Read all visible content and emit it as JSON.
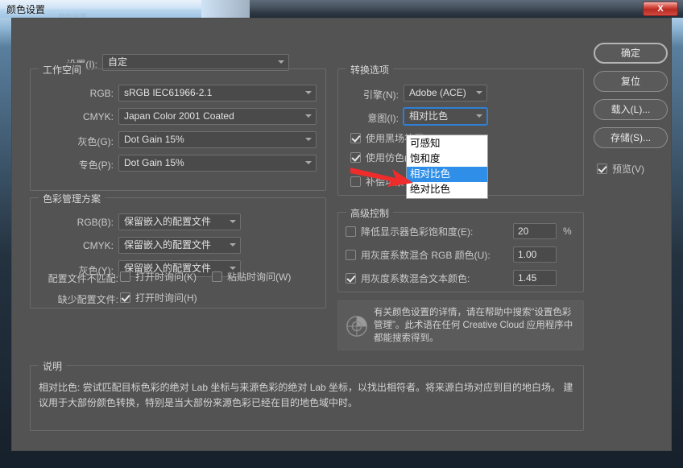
{
  "window": {
    "title": "颜色设置",
    "close_label": "X",
    "ghost_title": "颜色设置"
  },
  "settings_row": {
    "label": "设置(I):",
    "value": "自定"
  },
  "working_spaces": {
    "legend": "工作空间",
    "rows": [
      {
        "label": "RGB:",
        "value": "sRGB IEC61966-2.1"
      },
      {
        "label": "CMYK:",
        "value": "Japan Color 2001 Coated"
      },
      {
        "label": "灰色(G):",
        "value": "Dot Gain 15%"
      },
      {
        "label": "专色(P):",
        "value": "Dot Gain 15%"
      }
    ]
  },
  "color_management": {
    "legend": "色彩管理方案",
    "rows": [
      {
        "label": "RGB(B):",
        "value": "保留嵌入的配置文件"
      },
      {
        "label": "CMYK:",
        "value": "保留嵌入的配置文件"
      },
      {
        "label": "灰色(Y):",
        "value": "保留嵌入的配置文件"
      }
    ],
    "mismatch_label": "配置文件不匹配:",
    "mismatch_open": {
      "label": "打开时询问(K)",
      "checked": false
    },
    "mismatch_paste": {
      "label": "粘贴时询问(W)",
      "checked": false
    },
    "missing_label": "缺少配置文件:",
    "missing_open": {
      "label": "打开时询问(H)",
      "checked": true
    }
  },
  "conversion_options": {
    "legend": "转换选项",
    "engine_label": "引擎(N):",
    "engine_value": "Adobe (ACE)",
    "intent_label": "意图(I):",
    "intent_value": "相对比色",
    "intent_options": [
      "可感知",
      "饱和度",
      "相对比色",
      "绝对比色"
    ],
    "intent_selected_index": 2,
    "black_point": {
      "label": "使用黑场补偿(A)",
      "checked": true
    },
    "dither": {
      "label": "使用仿色(8位/通道图像)(D)",
      "checked": true
    },
    "scene_referred": {
      "label": "补偿场景参考配置文件(E)",
      "checked": false
    }
  },
  "advanced_controls": {
    "legend": "高级控制",
    "desaturate": {
      "label": "降低显示器色彩饱和度(E):",
      "checked": false,
      "value": "20",
      "unit": "%"
    },
    "blend_rgb": {
      "label": "用灰度系数混合 RGB 颜色(U):",
      "checked": false,
      "value": "1.00"
    },
    "blend_text": {
      "label": "用灰度系数混合文本颜色:",
      "checked": true,
      "value": "1.45"
    }
  },
  "info_note": {
    "text": "有关颜色设置的详情，请在帮助中搜索“设置色彩管理”。此术语在任何 Creative Cloud 应用程序中都能搜索得到。"
  },
  "buttons": {
    "ok": "确定",
    "reset": "复位",
    "load": "载入(L)...",
    "save": "存储(S)...",
    "preview": {
      "label": "预览(V)",
      "checked": true
    }
  },
  "description": {
    "legend": "说明",
    "text": "相对比色: 尝试匹配目标色彩的绝对 Lab 坐标与来源色彩的绝对 Lab 坐标，以找出相符者。将来源白场对应到目的地白场。 建议用于大部份颜色转换，特别是当大部份来源色彩已经在目的地色域中时。"
  },
  "colors": {
    "dialog_bg": "#535353",
    "accent_blue": "#2f8fe8",
    "annotation_red": "#ee2c2c"
  }
}
